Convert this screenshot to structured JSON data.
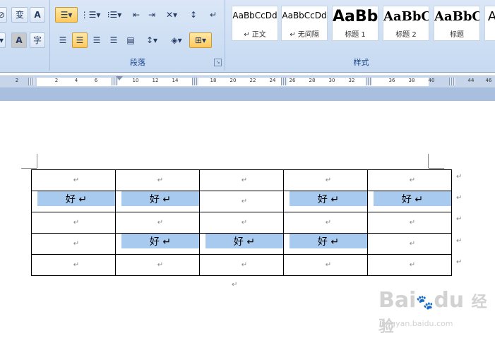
{
  "ribbon": {
    "paragraph_group_label": "段落",
    "styles_group_label": "样式",
    "font_glyphs": {
      "phonetic": "变",
      "font_box": "A",
      "char_shade": "A",
      "enclose": "字"
    },
    "styles": [
      {
        "sample": "AaBbCcDd",
        "name": "↵ 正文"
      },
      {
        "sample": "AaBbCcDd",
        "name": "↵ 无间隔"
      },
      {
        "sample": "AaBb",
        "name": "标题 1"
      },
      {
        "sample": "AaBbC",
        "name": "标题 2"
      },
      {
        "sample": "AaBbC",
        "name": "标题"
      },
      {
        "sample": "A",
        "name": ""
      }
    ]
  },
  "ruler": {
    "left_ticks": [
      "2"
    ],
    "ticks": [
      "2",
      "4",
      "6",
      "10",
      "12",
      "14",
      "18",
      "20",
      "22",
      "24",
      "26",
      "28",
      "30",
      "32",
      "36",
      "38",
      "40",
      "44",
      "46"
    ]
  },
  "table": {
    "rows": [
      [
        "↵",
        "↵",
        "↵",
        "↵",
        "↵"
      ],
      [
        "好 ↵",
        "好 ↵",
        "↵",
        "好 ↵",
        "好 ↵"
      ],
      [
        "↵",
        "↵",
        "↵",
        "↵",
        "↵"
      ],
      [
        "↵",
        "好 ↵",
        "好 ↵",
        "好 ↵",
        "↵"
      ],
      [
        "↵",
        "↵",
        "↵",
        "↵",
        "↵"
      ]
    ],
    "highlighted": [
      [
        false,
        false,
        false,
        false,
        false
      ],
      [
        true,
        true,
        false,
        true,
        true
      ],
      [
        false,
        false,
        false,
        false,
        false
      ],
      [
        false,
        true,
        true,
        true,
        false
      ],
      [
        false,
        false,
        false,
        false,
        false
      ]
    ],
    "row_end_mark": "↵",
    "end_paragraph_mark": "↵"
  },
  "watermark": {
    "brand": "Bai",
    "brand_du": "du",
    "product": "经验",
    "url": "jingyan.baidu.com"
  },
  "colors": {
    "highlight": "#a9caef",
    "ribbon": "#c5d9f1",
    "group_label": "#15428b"
  }
}
